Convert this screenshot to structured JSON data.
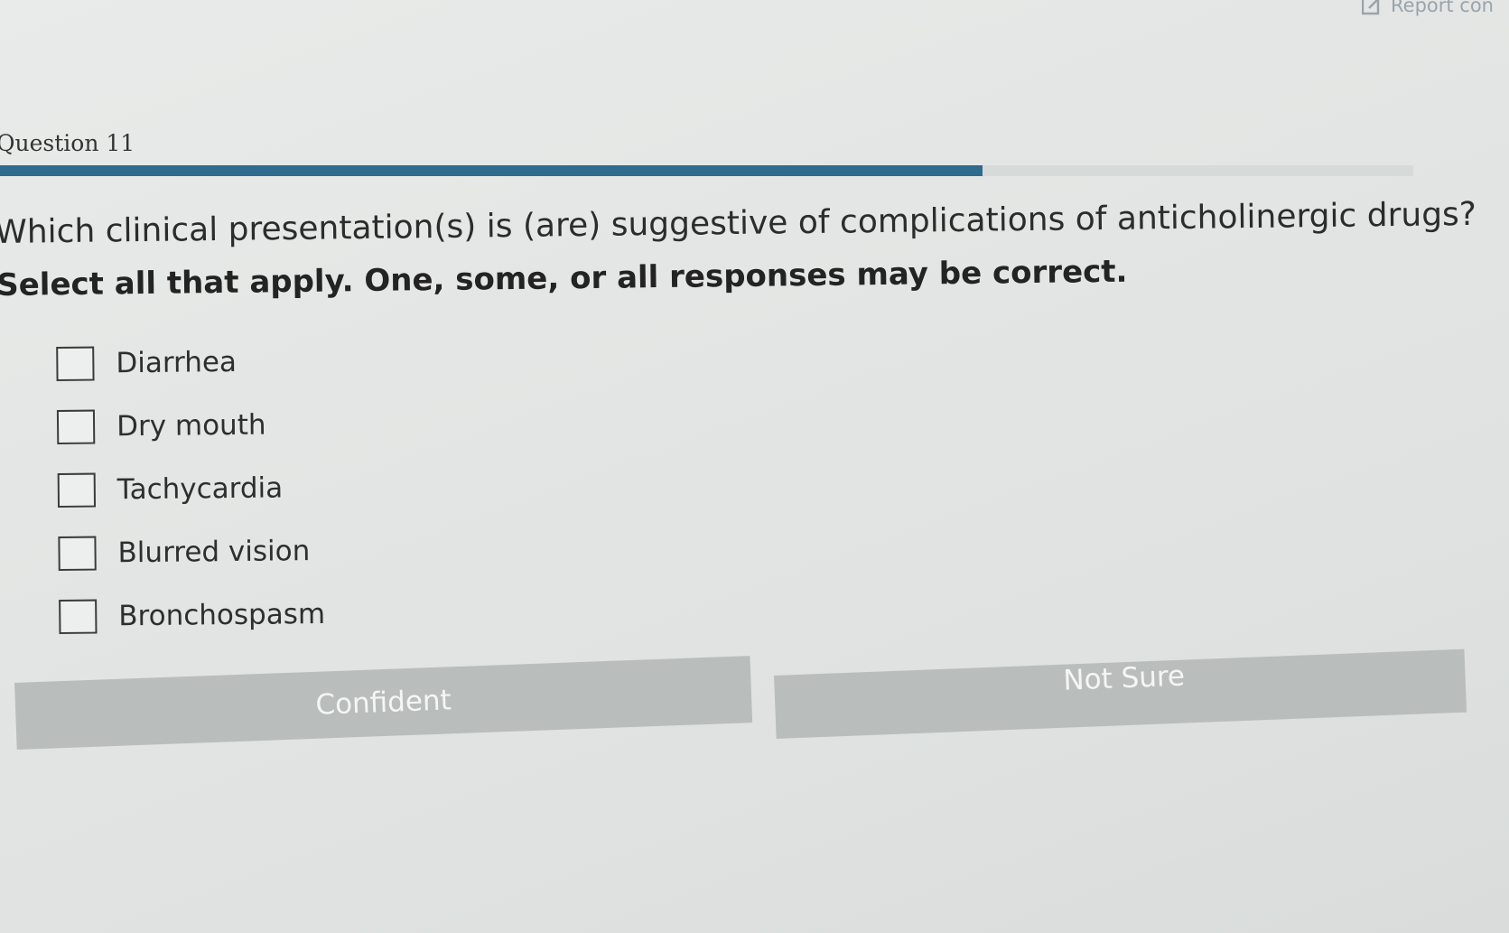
{
  "report": {
    "label": "Report con",
    "icon": "edit-icon"
  },
  "question": {
    "label": "Question 11",
    "text": "Which clinical presentation(s) is (are) suggestive of complications of anticholinergic drugs?",
    "instruction": "Select all that apply. One, some, or all responses may be correct."
  },
  "progress": {
    "fraction": 0.695,
    "color": "#2f6b8e"
  },
  "options": [
    {
      "label": "Diarrhea",
      "checked": false
    },
    {
      "label": "Dry mouth",
      "checked": false
    },
    {
      "label": "Tachycardia",
      "checked": false
    },
    {
      "label": "Blurred vision",
      "checked": false
    },
    {
      "label": "Bronchospasm",
      "checked": false
    }
  ],
  "buttons": {
    "confident": "Confident",
    "not_sure": "Not Sure"
  }
}
